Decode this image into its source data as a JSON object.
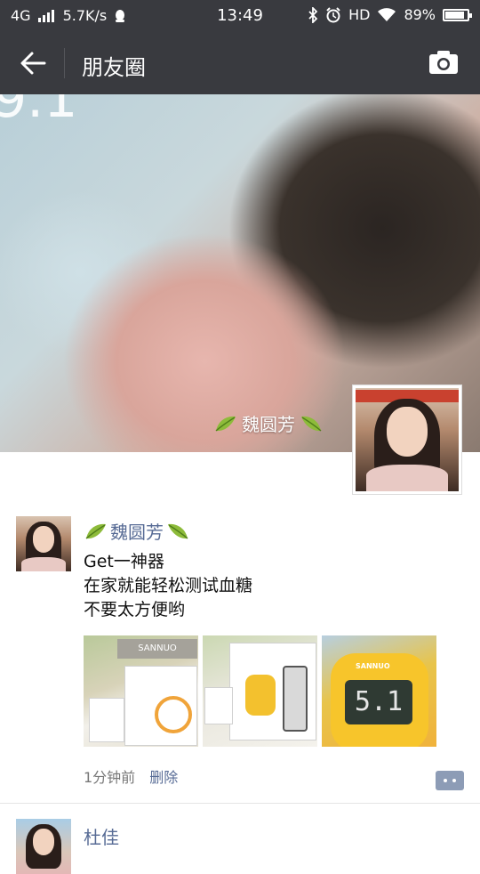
{
  "status_bar": {
    "network": "4G",
    "speed": "5.7K/s",
    "time": "13:49",
    "hd": "HD",
    "battery": "89%"
  },
  "nav": {
    "title": "朋友圈"
  },
  "cover": {
    "corner_text": "9.1",
    "name": "魏圆芳"
  },
  "post": {
    "author": "魏圆芳",
    "text_lines": [
      "Get一神器",
      "在家就能轻松测试血糖",
      "不要太方便哟"
    ],
    "photos": [
      {
        "brand": "SANNUO"
      },
      {
        "brand": ""
      },
      {
        "brand": "SANNUO",
        "reading": "5.1"
      }
    ],
    "time_ago": "1分钟前",
    "delete_label": "删除"
  },
  "next_post": {
    "author": "杜佳"
  },
  "colors": {
    "bar": "#393a3f",
    "link": "#576b95"
  }
}
